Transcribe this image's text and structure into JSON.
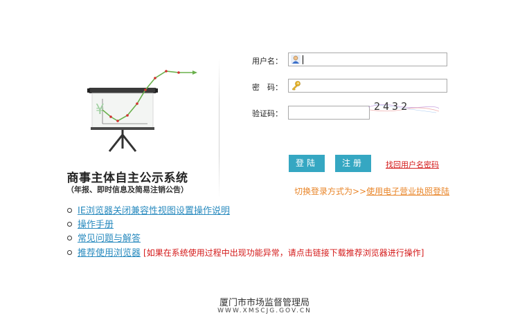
{
  "brand": {
    "title": "商事主体自主公示系统",
    "subtitle": "（年报、即时信息及简易注销公告）"
  },
  "login": {
    "username_label": "用户名：",
    "password_label": "密　码：",
    "captcha_label": "验证码：",
    "captcha_text": "2432",
    "username_value": "",
    "password_value": "",
    "captcha_value": "",
    "login_button": "登陆",
    "register_button": "注册",
    "find_account_link": "找回用户名密码",
    "switch_prefix": "切换登录方式为>>",
    "switch_link": "使用电子营业执照登陆"
  },
  "links": [
    {
      "label": "IE浏览器关闭兼容性视图设置操作说明",
      "note": ""
    },
    {
      "label": "操作手册",
      "note": ""
    },
    {
      "label": "常见问题与解答",
      "note": ""
    },
    {
      "label": "推荐使用浏览器",
      "note": "[如果在系统使用过程中出现功能异常，请点击链接下载推荐浏览器进行操作]"
    }
  ],
  "footer": {
    "org": "厦门市市场监督管理局",
    "url": "WWW.XMSCJG.GOV.CN"
  },
  "colors": {
    "button": "#35a7c2",
    "link": "#2a8bbf",
    "warning": "#d41919",
    "switch": "#e9862a"
  },
  "icons": {
    "username": "user-icon",
    "password": "key-icon"
  }
}
